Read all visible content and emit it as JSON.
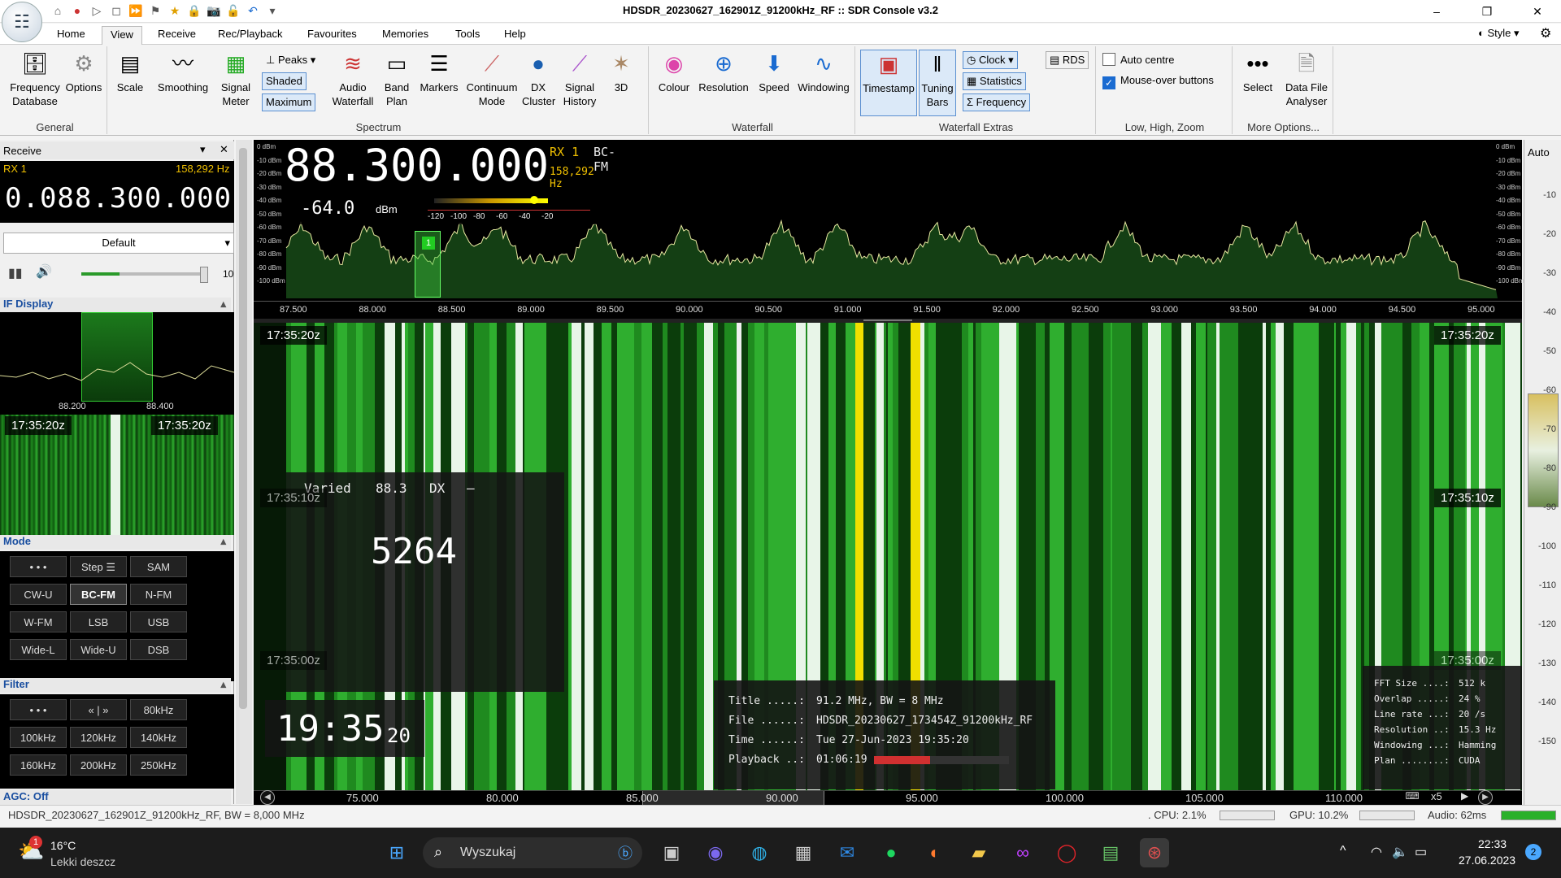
{
  "window": {
    "title": "HDSDR_20230627_162901Z_91200kHz_RF :: SDR Console v3.2",
    "min": "–",
    "max": "❐",
    "close": "✕"
  },
  "menu": {
    "tabs": [
      "Home",
      "View",
      "Receive",
      "Rec/Playback",
      "Favourites",
      "Memories",
      "Tools",
      "Help"
    ],
    "active": "View",
    "style": "Style"
  },
  "ribbon": {
    "general": {
      "label": "General",
      "buttons": [
        {
          "label": "Frequency Database"
        },
        {
          "label": "Options"
        }
      ]
    },
    "spectrum": {
      "label": "Spectrum",
      "scale": "Scale",
      "smoothing": "Smoothing",
      "signal_meter": "Signal Meter",
      "peaks": "Peaks",
      "shaded": "Shaded",
      "maximum": "Maximum",
      "audio_waterfall": "Audio Waterfall",
      "band_plan": "Band Plan",
      "markers": "Markers",
      "continuum_mode": "Continuum Mode",
      "dx_cluster": "DX Cluster",
      "signal_history": "Signal History",
      "threed": "3D"
    },
    "waterfall": {
      "label": "Waterfall",
      "colour": "Colour",
      "resolution": "Resolution",
      "speed": "Speed",
      "windowing": "Windowing"
    },
    "extras": {
      "label": "Waterfall Extras",
      "timestamp": "Timestamp",
      "tuning_bars": "Tuning Bars",
      "clock": "Clock",
      "statistics": "Statistics",
      "frequency": "Frequency",
      "rds": "RDS"
    },
    "lhz": {
      "label": "Low, High, Zoom",
      "auto_centre": "Auto centre",
      "mouse_over": "Mouse-over buttons"
    },
    "more": {
      "label": "More Options...",
      "select": "Select",
      "data_file_analyser": "Data File Analyser"
    }
  },
  "receive": {
    "header": "Receive",
    "rx": "RX 1",
    "offset": "158,292 Hz",
    "frequency": "0.088.300.000",
    "profile": "Default",
    "volume_value": "10",
    "if_display": "IF Display",
    "if_left": "88.200",
    "if_right": "88.400",
    "if_time": "17:35:20z",
    "mode_label": "Mode",
    "modes": [
      "• • •",
      "Step ☰",
      "SAM",
      "CW-U",
      "BC-FM",
      "N-FM",
      "W-FM",
      "LSB",
      "USB",
      "Wide-L",
      "Wide-U",
      "DSB"
    ],
    "filter_label": "Filter",
    "filters": [
      "• • •",
      "« | »",
      "80kHz",
      "100kHz",
      "120kHz",
      "140kHz",
      "160kHz",
      "200kHz",
      "250kHz"
    ],
    "agc": "AGC: Off"
  },
  "spectrum": {
    "main_freq": "88.300.000",
    "rx": "RX 1",
    "mode": "BC-FM",
    "offset": "158,292 Hz",
    "level": "-64.0",
    "unit": "dBm",
    "meter_ticks": [
      "-120",
      "-100",
      "-80",
      "-60",
      "-40",
      "-20"
    ],
    "dbm_labels": [
      "0 dBm",
      "-10 dBm",
      "-20 dBm",
      "-30 dBm",
      "-40 dBm",
      "-50 dBm",
      "-60 dBm",
      "-70 dBm",
      "-80 dBm",
      "-90 dBm",
      "-100 dBm"
    ],
    "freq_ticks": [
      "87.500",
      "88.000",
      "88.500",
      "89.000",
      "89.500",
      "90.000",
      "90.500",
      "91.000",
      "91.500",
      "92.000",
      "92.500",
      "93.000",
      "93.500",
      "94.000",
      "94.500",
      "95.000"
    ],
    "marker": "1"
  },
  "waterfall": {
    "times": [
      "17:35:20z",
      "17:35:10z",
      "17:35:00z"
    ],
    "rds": {
      "pty": "Varied",
      "freq": "88.3",
      "type": "DX",
      "dash": "–",
      "pi": "5264"
    },
    "clock": "19:35",
    "clock_sec": "20",
    "file_info": [
      {
        "k": "Title .....:",
        "v": "91.2 MHz, BW = 8 MHz"
      },
      {
        "k": "File ......:",
        "v": "HDSDR_20230627_173454Z_91200kHz_RF"
      },
      {
        "k": "Time ......:",
        "v": "Tue 27-Jun-2023 19:35:20"
      },
      {
        "k": "Playback ..:",
        "v": "01:06:19"
      }
    ],
    "playback_progress": 0.42,
    "stats": [
      {
        "k": "FFT Size ....:",
        "v": "512 k"
      },
      {
        "k": "Overlap .....:",
        "v": "24 %"
      },
      {
        "k": "Line rate ...:",
        "v": "20 /s"
      },
      {
        "k": "Resolution ..:",
        "v": "15.3 Hz"
      },
      {
        "k": "Windowing ...:",
        "v": "Hamming"
      },
      {
        "k": "Plan ........:",
        "v": "CUDA"
      }
    ],
    "bottom_ticks": [
      "75.000",
      "80.000",
      "85.000",
      "90.000",
      "95.000",
      "100.000",
      "105.000",
      "110.000"
    ],
    "zoom": "x5"
  },
  "right_scale": {
    "auto": "Auto",
    "labels": [
      "-10",
      "-20",
      "-30",
      "-40",
      "-50",
      "-60",
      "-70",
      "-80",
      "-90",
      "-100",
      "-110",
      "-120",
      "-130",
      "-140",
      "-150"
    ]
  },
  "status": {
    "file": "HDSDR_20230627_162901Z_91200kHz_RF, BW = 8,000 MHz",
    "cpu": ". CPU: 2.1%",
    "gpu": "GPU: 10.2%",
    "audio": "Audio: 62ms"
  },
  "taskbar": {
    "temp": "16°C",
    "weather": "Lekki deszcz",
    "search": "Wyszukaj",
    "time": "22:33",
    "date": "27.06.2023",
    "badge": "1",
    "notif": "2"
  },
  "colors": {
    "wf_green": "#1f8a1f",
    "accent": "#1a6bd1",
    "yellow": "#f0e000",
    "red": "#d03030"
  }
}
